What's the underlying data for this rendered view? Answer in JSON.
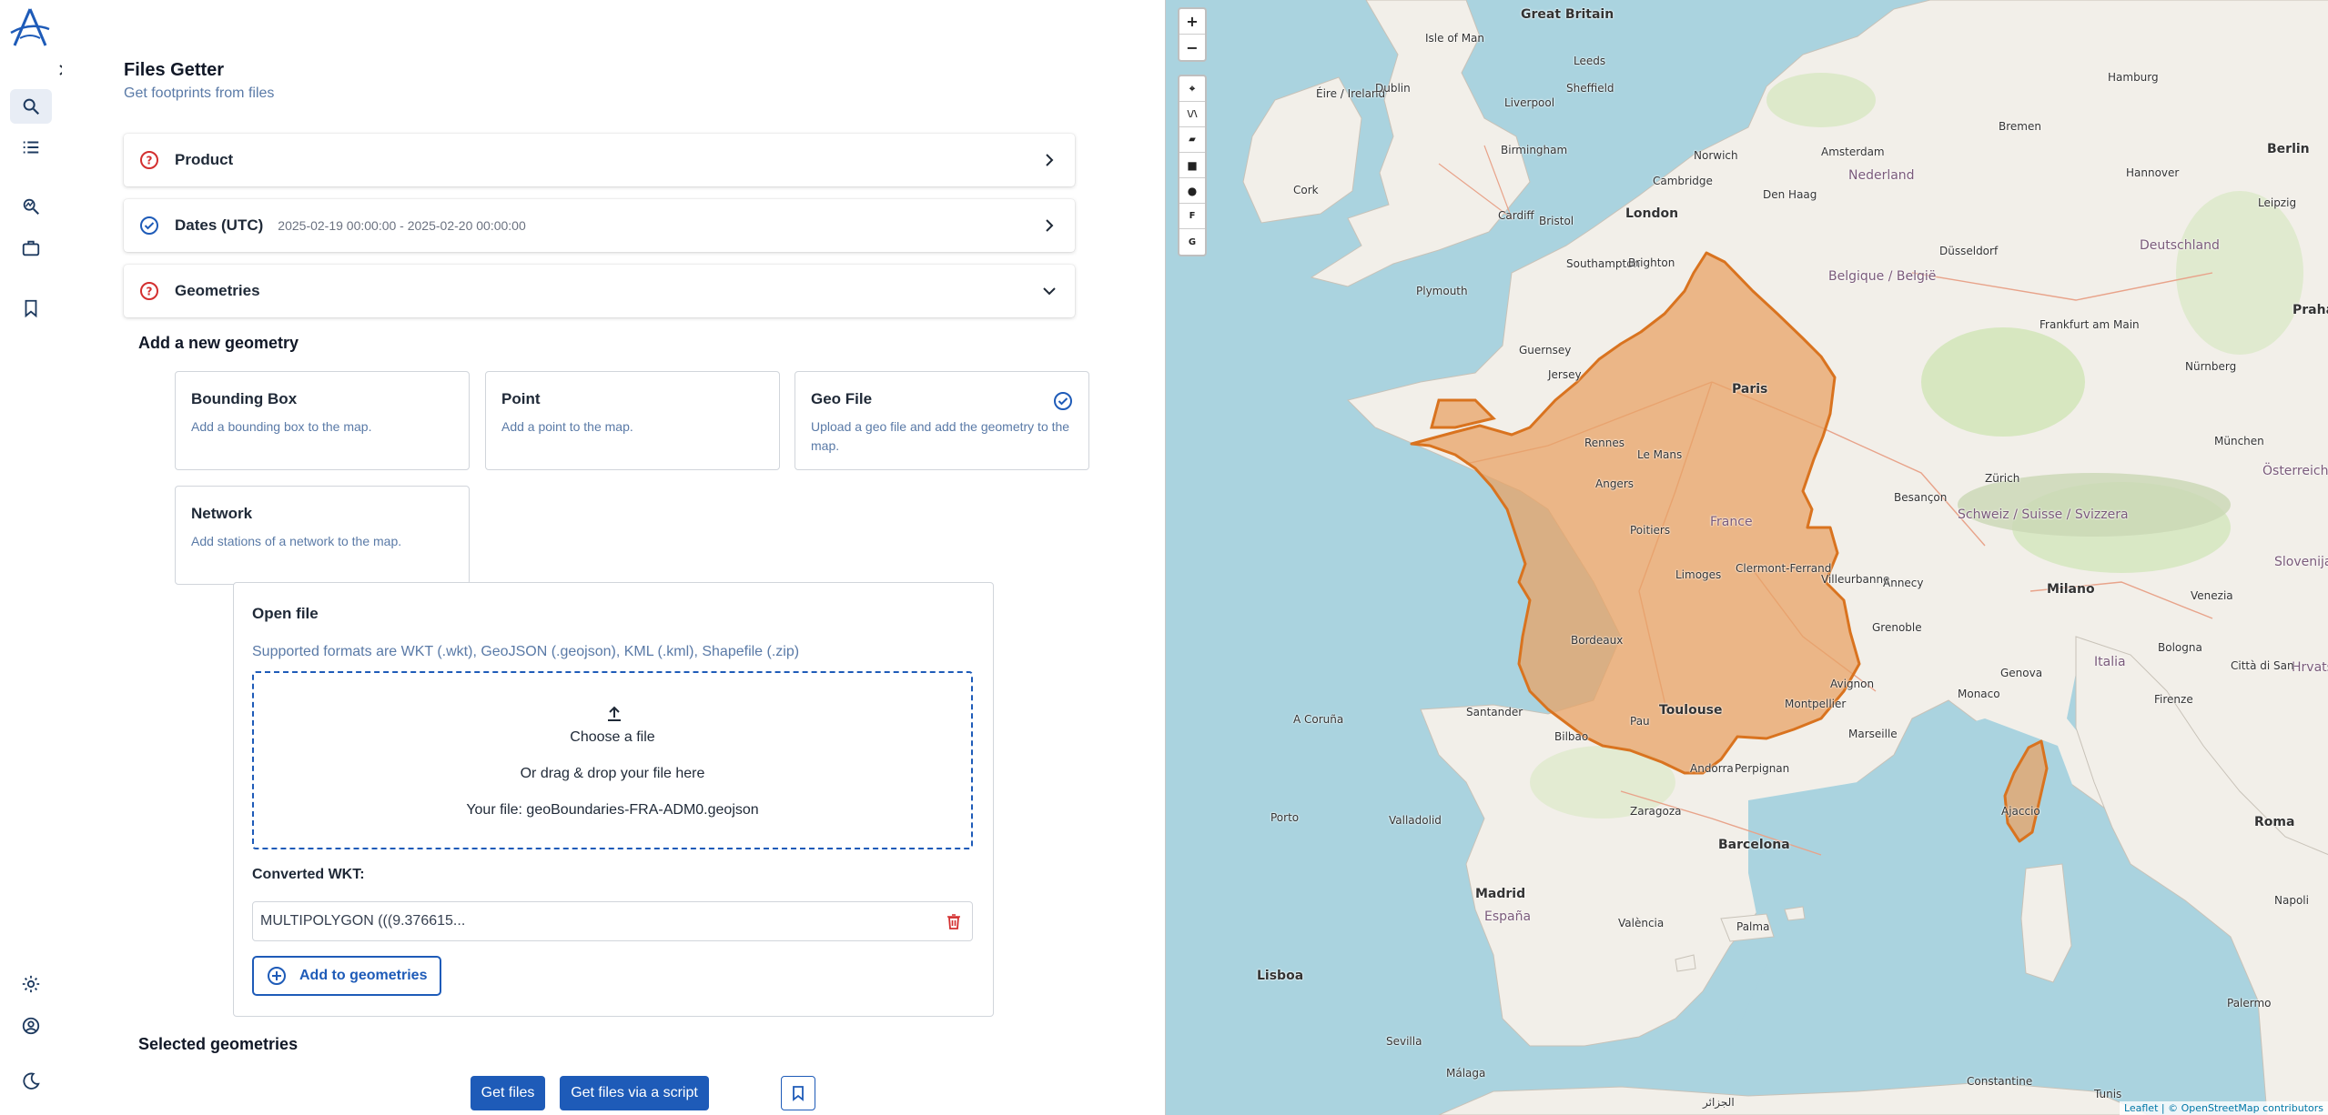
{
  "header": {
    "title": "Files Getter",
    "subtitle": "Get footprints from files"
  },
  "accordions": [
    {
      "label": "Product",
      "status": "warning",
      "value": ""
    },
    {
      "label": "Dates (UTC)",
      "status": "ok",
      "value": "2025-02-19 00:00:00 - 2025-02-20 00:00:00"
    },
    {
      "label": "Geometries",
      "status": "warning",
      "value": ""
    }
  ],
  "add_geometry": {
    "heading": "Add a new geometry",
    "options": [
      {
        "title": "Bounding Box",
        "desc": "Add a bounding box to the map.",
        "selected": false
      },
      {
        "title": "Point",
        "desc": "Add a point to the map.",
        "selected": false
      },
      {
        "title": "Geo File",
        "desc": "Upload a geo file and add the geometry to the map.",
        "selected": true
      },
      {
        "title": "Network",
        "desc": "Add stations of a network to the map.",
        "selected": false
      }
    ]
  },
  "open_file": {
    "title": "Open file",
    "formats": "Supported formats are WKT (.wkt), GeoJSON (.geojson), KML (.kml), Shapefile (.zip)",
    "choose": "Choose a file",
    "drag": "Or drag & drop your file here",
    "your_file": "Your file: geoBoundaries-FRA-ADM0.geojson",
    "converted_label": "Converted WKT:",
    "wkt_value": "MULTIPOLYGON (((9.376615...",
    "add_button": "Add to geometries"
  },
  "selected": {
    "heading": "Selected geometries"
  },
  "actions": {
    "get_files": "Get files",
    "get_files_script": "Get files via a script"
  },
  "map": {
    "zoom_in": "+",
    "zoom_out": "−",
    "tools": [
      "⌖",
      "\\/\\",
      "▰",
      "■",
      "●",
      "F",
      "G"
    ],
    "labels": {
      "great_britain": "Great Britain",
      "isle_of_man": "Isle of Man",
      "eire": "Éire / Ireland",
      "dublin": "Dublin",
      "leeds": "Leeds",
      "liverpool": "Liverpool",
      "sheffield": "Sheffield",
      "birmingham": "Birmingham",
      "cork": "Cork",
      "cambridge": "Cambridge",
      "norwich": "Norwich",
      "cardiff": "Cardiff",
      "london": "London",
      "bristol": "Bristol",
      "southampton": "Southampton",
      "brighton": "Brighton",
      "plymouth": "Plymouth",
      "guernsey": "Guernsey",
      "jersey": "Jersey",
      "den_haag": "Den Haag",
      "nederland": "Nederland",
      "amsterdam": "Amsterdam",
      "hamburg": "Hamburg",
      "bremen": "Bremen",
      "berlin": "Berlin",
      "hannover": "Hannover",
      "deutschland": "Deutschland",
      "leipzig": "Leipzig",
      "dusseldorf": "Düsseldorf",
      "belgique": "Belgique / België",
      "frankfurt": "Frankfurt am Main",
      "nurnberg": "Nürnberg",
      "praha": "Praha",
      "munchen": "München",
      "osterreich": "Österreich",
      "zurich": "Zürich",
      "schweiz": "Schweiz / Suisse / Svizzera",
      "paris": "Paris",
      "rennes": "Rennes",
      "le_mans": "Le Mans",
      "angers": "Angers",
      "france": "France",
      "poitiers": "Poitiers",
      "limoges": "Limoges",
      "clermont": "Clermont-Ferrand",
      "villeurbanne": "Villeurbanne",
      "annecy": "Annecy",
      "grenoble": "Grenoble",
      "besancon": "Besançon",
      "bordeaux": "Bordeaux",
      "toulouse": "Toulouse",
      "montpellier": "Montpellier",
      "avignon": "Avignon",
      "marseille": "Marseille",
      "monaco": "Monaco",
      "pau": "Pau",
      "perpignan": "Perpignan",
      "andorra": "Andorra",
      "milano": "Milano",
      "genova": "Genova",
      "italia": "Italia",
      "firenze": "Firenze",
      "bologna": "Bologna",
      "venezia": "Venezia",
      "slovenija": "Slovenija",
      "hrvatska": "Hrvatska",
      "citta_san": "Città di San",
      "ajaccio": "Ajaccio",
      "roma": "Roma",
      "napoli": "Napoli",
      "palermo": "Palermo",
      "espana": "España",
      "madrid": "Madrid",
      "barcelona": "Barcelona",
      "zaragoza": "Zaragoza",
      "bilbao": "Bilbao",
      "la_coruna": "A Coruña",
      "santander": "Santander",
      "valencia": "València",
      "palma": "Palma",
      "lisboa": "Lisboa",
      "sevilla": "Sevilla",
      "malaga": "Málaga",
      "porto": "Porto",
      "valladolid": "Valladolid",
      "tunis": "Tunis",
      "alger": "الجزائر",
      "constantine": "Constantine"
    },
    "attribution": "Leaflet | © OpenStreetMap contributors"
  },
  "colors": {
    "accent": "#1e5bb8",
    "warning": "#d32f2f",
    "sea": "#aad3df",
    "land": "#f2efe9",
    "polygon_fill": "#e8a366",
    "polygon_stroke": "#d9731f"
  }
}
